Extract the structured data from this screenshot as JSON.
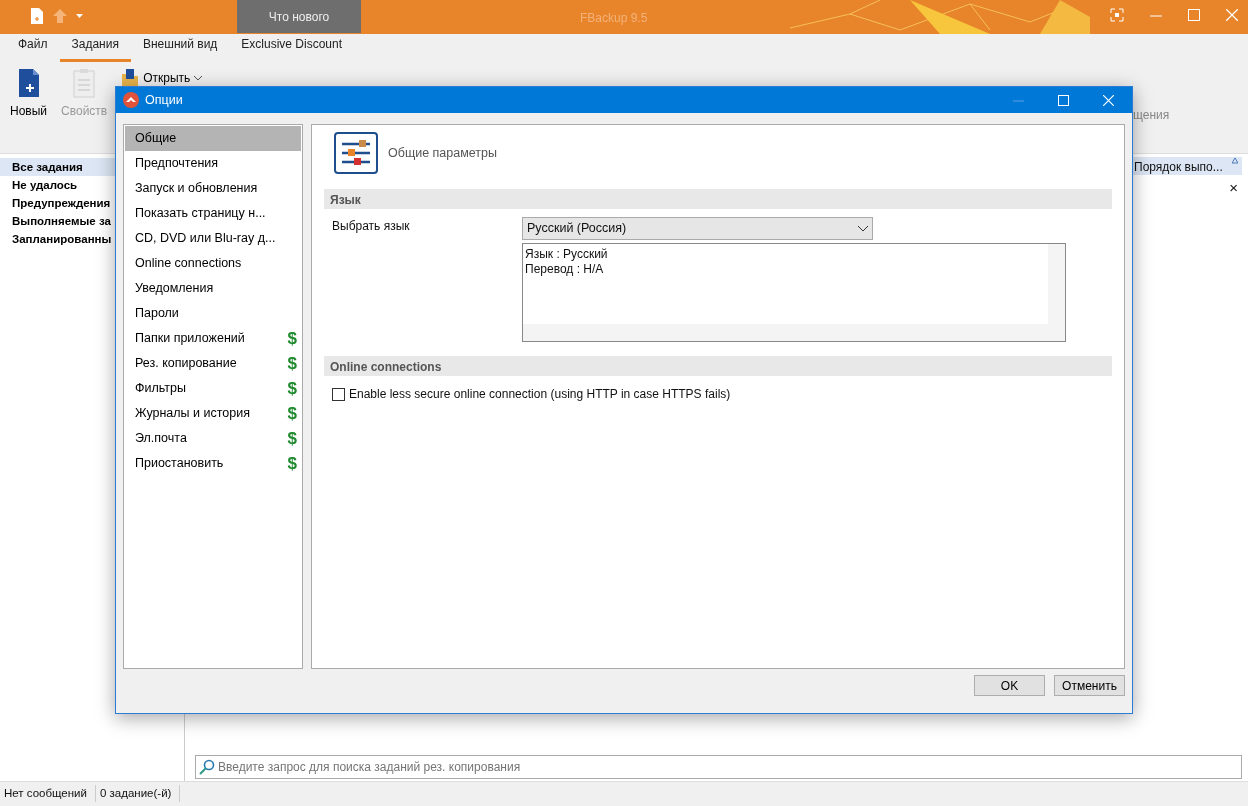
{
  "app": {
    "title": "FBackup 9.5",
    "whats_new_tab": "Что нового"
  },
  "menu_tabs": [
    {
      "label": "Файл",
      "selected": false
    },
    {
      "label": "Задания",
      "selected": true
    },
    {
      "label": "Внешний вид",
      "selected": false
    },
    {
      "label": "Exclusive Discount",
      "selected": false
    }
  ],
  "ribbon": [
    {
      "kind": "new",
      "label": "Новый",
      "disabled": false
    },
    {
      "kind": "properties",
      "label": "Свойств",
      "disabled": true
    },
    {
      "kind": "open",
      "label": "Открыть",
      "disabled": false
    }
  ],
  "ribbon_right_label": "щения",
  "nav": [
    {
      "label": "Все задания",
      "selected": true
    },
    {
      "label": "Не удалось",
      "selected": false
    },
    {
      "label": "Предупреждения",
      "selected": false
    },
    {
      "label": "Выполняемые за",
      "selected": false
    },
    {
      "label": "Запланированны",
      "selected": false
    }
  ],
  "list": {
    "column_1": "Порядок выпо...",
    "close": "×"
  },
  "search": {
    "placeholder": "Введите запрос для поиска заданий рез. копирования"
  },
  "status_bar": [
    "Нет сообщений",
    "0 задание(-й)"
  ],
  "dialog": {
    "title": "Опции",
    "categories": [
      {
        "label": "Общие",
        "selected": true
      },
      {
        "label": "Предпочтения",
        "selected": false
      },
      {
        "label": "Запуск и обновления",
        "selected": false
      },
      {
        "label": "Показать страницу н...",
        "selected": false
      },
      {
        "label": "CD, DVD или Blu-ray д...",
        "selected": false
      },
      {
        "label": "Online connections",
        "selected": false
      },
      {
        "label": "Уведомления",
        "selected": false
      },
      {
        "label": "Пароли",
        "selected": false
      },
      {
        "label": "Папки приложений",
        "selected": false,
        "badge": "$"
      },
      {
        "label": "Рез. копирование",
        "selected": false,
        "badge": "$"
      },
      {
        "label": "Фильтры",
        "selected": false,
        "badge": "$"
      },
      {
        "label": "Журналы и история",
        "selected": false,
        "badge": "$"
      },
      {
        "label": "Эл.почта",
        "selected": false,
        "badge": "$"
      },
      {
        "label": "Приостановить",
        "selected": false,
        "badge": "$"
      }
    ],
    "header": "Общие параметры",
    "language": {
      "title": "Язык",
      "label": "Выбрать язык",
      "value": "Русский (Россия)",
      "info": [
        "Язык : Русский",
        "Перевод : Н/А"
      ]
    },
    "online": {
      "title": "Online connections",
      "checkbox": {
        "label": "Enable less secure online connection (using HTTP in case HTTPS fails)",
        "checked": false
      }
    },
    "buttons": [
      "OK",
      "Отменить"
    ]
  }
}
